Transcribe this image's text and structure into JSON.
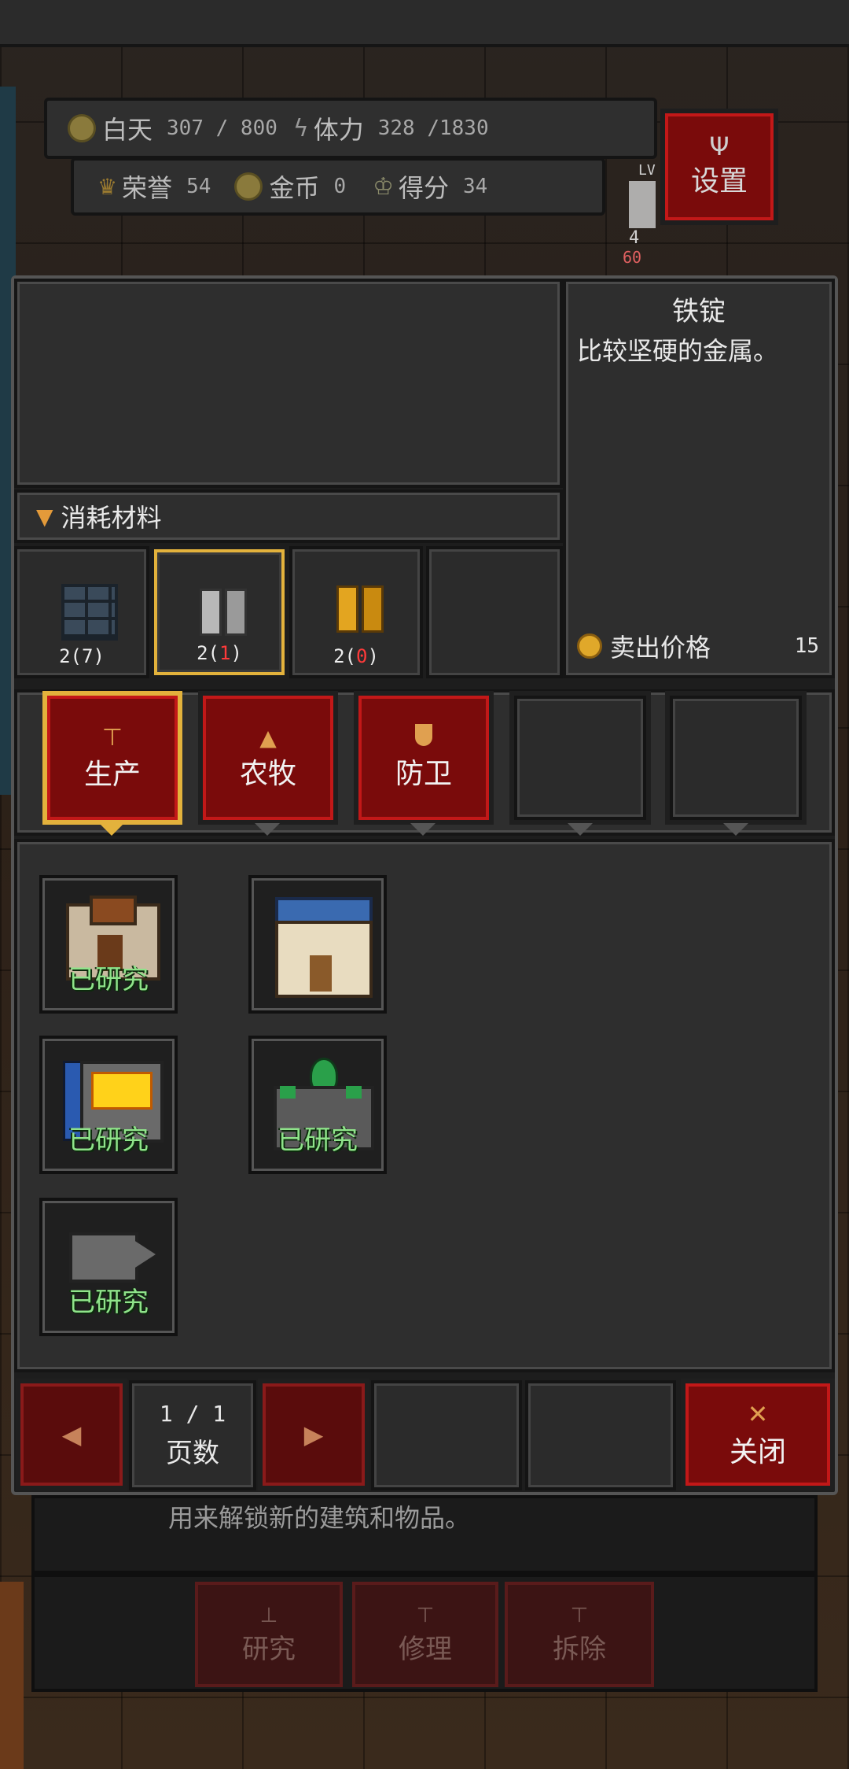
{
  "hud": {
    "day_label": "白天",
    "day_value": "307 / 800",
    "stamina_label": "体力",
    "stamina_value": "328 /1830",
    "honor_label": "荣誉",
    "honor_value": "54",
    "gold_label": "金币",
    "gold_value": "0",
    "score_label": "得分",
    "score_value": "34",
    "settings_label": "设置",
    "unit_level": "LV",
    "unit_count": "4",
    "unit_hp": "60"
  },
  "item": {
    "name": "铁锭",
    "description": "比较坚硬的金属。",
    "sell_label": "卖出价格",
    "sell_value": "15"
  },
  "materials": {
    "header": "消耗材料",
    "slots": [
      {
        "icon": "stone-brick-icon",
        "need": "2",
        "have": "7",
        "have_color": "#ffffff"
      },
      {
        "icon": "iron-ingot-icon",
        "need": "2",
        "have": "1",
        "have_color": "#ff3a3a"
      },
      {
        "icon": "gold-ingot-icon",
        "need": "2",
        "have": "0",
        "have_color": "#ff3a3a"
      }
    ]
  },
  "tabs": [
    {
      "label": "生产",
      "icon": "anvil-icon",
      "active": true
    },
    {
      "label": "农牧",
      "icon": "tree-icon",
      "active": false
    },
    {
      "label": "防卫",
      "icon": "shield-icon",
      "active": false
    }
  ],
  "buildings": [
    {
      "icon": "workshop-icon",
      "status": "已研究"
    },
    {
      "icon": "hall-icon",
      "status": ""
    },
    {
      "icon": "furnace-icon",
      "status": "已研究"
    },
    {
      "icon": "emerald-altar-icon",
      "status": "已研究"
    },
    {
      "icon": "anvil-block-icon",
      "status": "已研究"
    }
  ],
  "pager": {
    "current": "1",
    "sep": "/",
    "total": "1",
    "label": "页数",
    "prev_icon": "arrow-left-icon",
    "next_icon": "arrow-right-icon"
  },
  "close_label": "关闭",
  "under": {
    "text": "用来解锁新的建筑和物品。",
    "research": "研究",
    "repair": "修理",
    "demolish": "拆除"
  },
  "colors": {
    "accent_red": "#7a0b0b",
    "highlight_gold": "#e3b23c",
    "researched_green": "#8fe38a",
    "insufficient_red": "#ff3a3a"
  }
}
